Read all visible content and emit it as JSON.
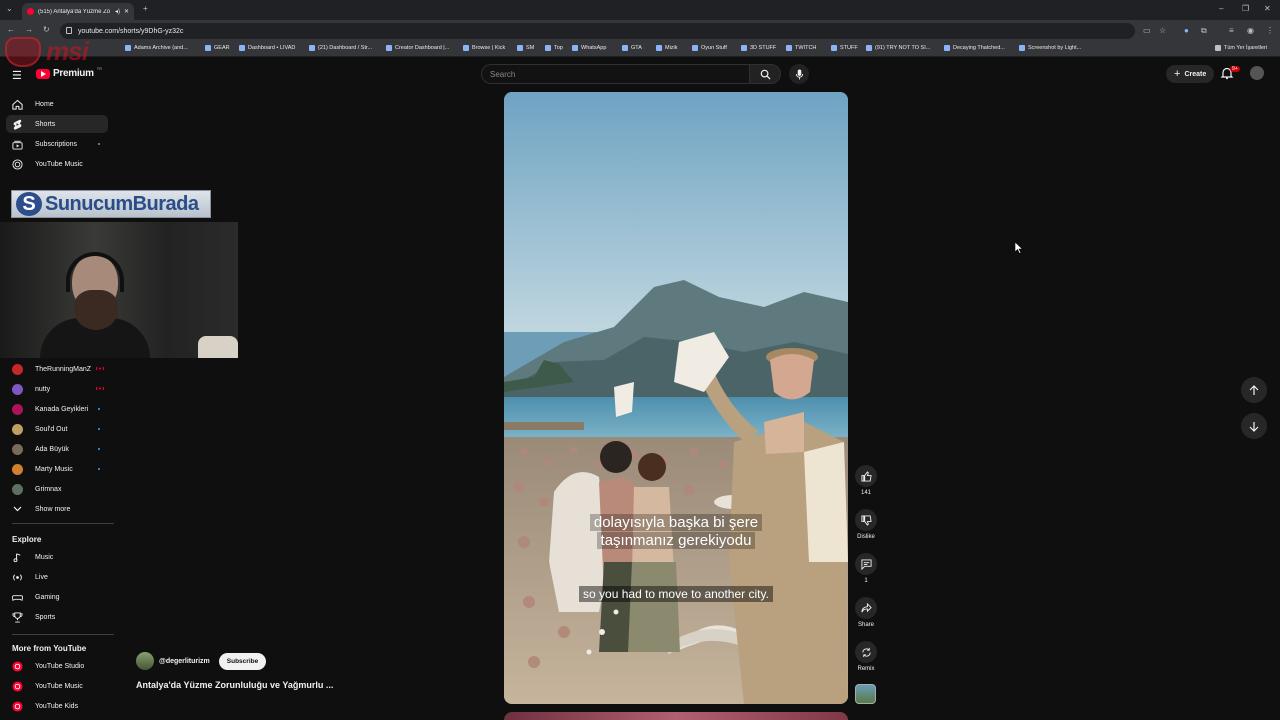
{
  "browser": {
    "tab_title": "(515) Antalya'da Yüzme Zo",
    "url": "youtube.com/shorts/y9DhG-yz32c",
    "bookmarks": [
      "Adams Archive (and...",
      "GEAR",
      "Dashboard • LIVAD",
      "(21) Dashboard / Str...",
      "Creator Dashboard |...",
      "Browse | Kick",
      "SM",
      "Top",
      "WhatsApp",
      "GTA",
      "Mizik",
      "Oyun Stuff",
      "3D STUFF",
      "TWITCH",
      "STUFF",
      "(91) TRY NOT TO SI...",
      "Decaying Thatched...",
      "Screenshot by Light..."
    ],
    "all_bookmarks": "Tüm Yer İşaretleri"
  },
  "overlay": {
    "logo": "msi",
    "banner_letter": "S",
    "banner_text": "SunucumBurada"
  },
  "header": {
    "logo_text": "Premium",
    "logo_sup": "TR",
    "search_placeholder": "Search",
    "create_label": "Create",
    "notif_badge": "9+"
  },
  "sidebar": {
    "main": [
      {
        "label": "Home",
        "icon": "home-icon"
      },
      {
        "label": "Shorts",
        "icon": "shorts-icon"
      },
      {
        "label": "Subscriptions",
        "icon": "subscriptions-icon"
      },
      {
        "label": "YouTube Music",
        "icon": "music-icon"
      }
    ],
    "subscriptions": [
      {
        "label": "TheRunningManZ",
        "color": "#c62828"
      },
      {
        "label": "nutty",
        "color": "#7e57c2"
      },
      {
        "label": "Kanada Geyikleri",
        "color": "#ad1457"
      },
      {
        "label": "Soul'd Out",
        "color": "#c0a060"
      },
      {
        "label": "Ada Büyük",
        "color": "#7a6a5a"
      },
      {
        "label": "Marty Music",
        "color": "#d08030"
      },
      {
        "label": "Grimnax",
        "color": "#607060"
      }
    ],
    "show_more": "Show more",
    "explore_heading": "Explore",
    "explore": [
      {
        "label": "Music",
        "icon": "music-note-icon"
      },
      {
        "label": "Live",
        "icon": "live-icon"
      },
      {
        "label": "Gaming",
        "icon": "gaming-icon"
      },
      {
        "label": "Sports",
        "icon": "trophy-icon"
      }
    ],
    "more_heading": "More from YouTube",
    "more": [
      {
        "label": "YouTube Studio"
      },
      {
        "label": "YouTube Music"
      },
      {
        "label": "YouTube Kids"
      }
    ]
  },
  "short": {
    "caption_tr_line1": "dolayısıyla başka bi şere",
    "caption_tr_line2": "taşınmanız gerekiyodu",
    "caption_en": "so you had to move to another city.",
    "channel": "@degerliturizm",
    "subscribe_label": "Subscribe",
    "title": "Antalya'da Yüzme Zorunluluğu ve Yağmurlu ...",
    "like_count": "141",
    "dislike_label": "Dislike",
    "comment_count": "1",
    "share_label": "Share",
    "remix_label": "Remix"
  },
  "colors": {
    "background": "#0f0f0f",
    "accent_red": "#ff0033",
    "chip": "#272727"
  }
}
